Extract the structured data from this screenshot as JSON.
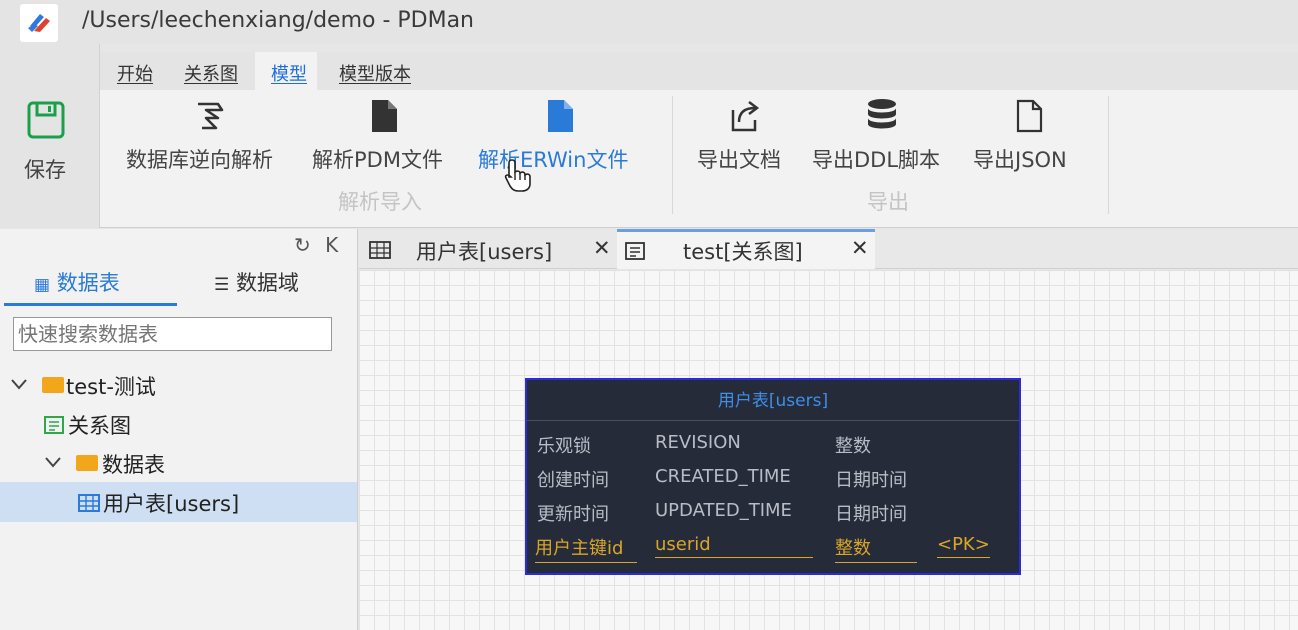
{
  "window": {
    "title": "/Users/leechenxiang/demo - PDMan",
    "icon": "pdman-logo-icon"
  },
  "ribbon": {
    "save_label": "保存",
    "menu_tabs": [
      {
        "label": "开始",
        "active": false
      },
      {
        "label": "关系图",
        "active": false
      },
      {
        "label": "模型",
        "active": true
      },
      {
        "label": "模型版本",
        "active": false
      }
    ],
    "import_group": {
      "label": "解析导入",
      "buttons": [
        {
          "label": "数据库逆向解析",
          "icon": "reverse-parse-icon"
        },
        {
          "label": "解析PDM文件",
          "icon": "file-icon"
        },
        {
          "label": "解析ERWin文件",
          "icon": "file-blue-icon"
        }
      ]
    },
    "export_group": {
      "label": "导出",
      "buttons": [
        {
          "label": "导出文档",
          "icon": "export-doc-icon"
        },
        {
          "label": "导出DDL脚本",
          "icon": "database-icon"
        },
        {
          "label": "导出JSON",
          "icon": "json-file-icon"
        }
      ]
    }
  },
  "left_panel": {
    "top_icons": {
      "refresh": "↻",
      "collapse": "K"
    },
    "tabs": [
      {
        "label": "数据表",
        "active": true
      },
      {
        "label": "数据域",
        "active": false
      }
    ],
    "search_placeholder": "快速搜索数据表",
    "tree": [
      {
        "label": "test-测试"
      },
      {
        "label": "关系图"
      },
      {
        "label": "数据表"
      },
      {
        "label": "用户表[users]",
        "selected": true
      }
    ]
  },
  "main": {
    "tabs": [
      {
        "label": "用户表[users]",
        "active": false
      },
      {
        "label": "test[关系图]",
        "active": true
      }
    ],
    "close_symbol": "✕",
    "entity": {
      "title": "用户表[users]",
      "rows": [
        {
          "name": "乐观锁",
          "code": "REVISION",
          "type": "整数",
          "key": ""
        },
        {
          "name": "创建时间",
          "code": "CREATED_TIME",
          "type": "日期时间",
          "key": ""
        },
        {
          "name": "更新时间",
          "code": "UPDATED_TIME",
          "type": "日期时间",
          "key": ""
        },
        {
          "name": "用户主键id",
          "code": "userid",
          "type": "整数",
          "key": "<PK>"
        }
      ]
    }
  },
  "colors": {
    "accent": "#2a7ad8",
    "save_green": "#1aa04a",
    "folder": "#f2a61c",
    "entity_bg": "#252b38",
    "entity_border": "#2b2bdc",
    "pk_gold": "#d9a52a"
  }
}
